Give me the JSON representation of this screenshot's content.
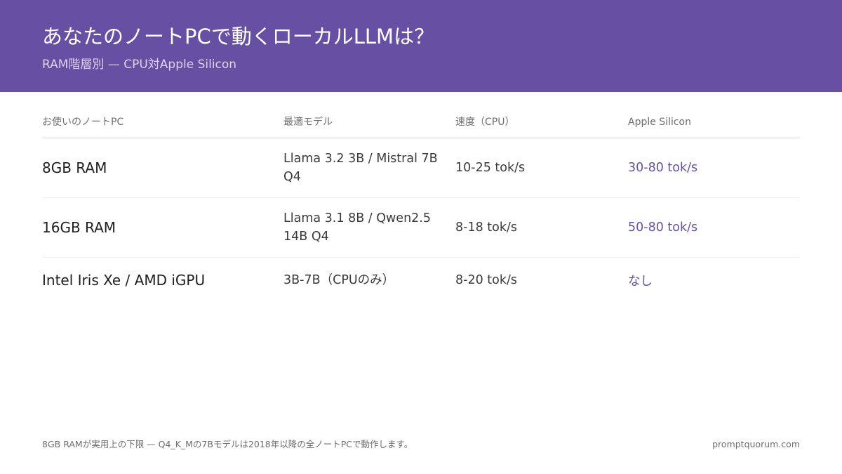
{
  "header": {
    "title": "あなたのノートPCで動くローカルLLMは？",
    "subtitle": "RAM階層別 — CPU対Apple Silicon"
  },
  "table": {
    "columns": [
      "お使いのノートPC",
      "最適モデル",
      "速度（CPU）",
      "Apple Silicon"
    ],
    "rows": [
      {
        "laptop": "8GB RAM",
        "model": "Llama 3.2 3B / Mistral 7B Q4",
        "cpu_speed": "10-25 tok/s",
        "apple_silicon": "30-80 tok/s"
      },
      {
        "laptop": "16GB RAM",
        "model": "Llama 3.1 8B / Qwen2.5 14B Q4",
        "cpu_speed": "8-18 tok/s",
        "apple_silicon": "50-80 tok/s"
      },
      {
        "laptop": "Intel Iris Xe / AMD iGPU",
        "model": "3B-7B（CPUのみ）",
        "cpu_speed": "8-20 tok/s",
        "apple_silicon": "なし"
      }
    ]
  },
  "footer": {
    "note": "8GB RAMが実用上の下限 — Q4_K_Mの7Bモデルは2018年以降の全ノートPCで動作します。",
    "brand": "promptquorum.com"
  },
  "colors": {
    "header_bg": "#674fa3",
    "accent": "#674fa3"
  }
}
